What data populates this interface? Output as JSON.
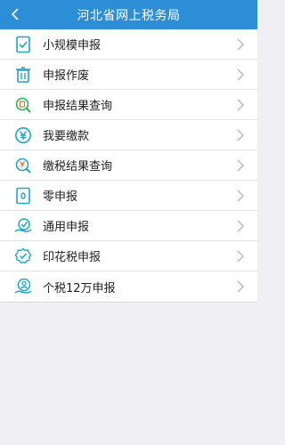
{
  "header": {
    "title": "河北省网上税务局"
  },
  "menu": [
    {
      "label": "小规模申报",
      "icon": "checklist-icon"
    },
    {
      "label": "申报作废",
      "icon": "trash-icon"
    },
    {
      "label": "申报结果查询",
      "icon": "search-document-icon"
    },
    {
      "label": "我要缴款",
      "icon": "yuan-circle-icon"
    },
    {
      "label": "缴税结果查询",
      "icon": "yuan-search-icon"
    },
    {
      "label": "零申报",
      "icon": "zero-document-icon"
    },
    {
      "label": "通用申报",
      "icon": "hand-check-icon"
    },
    {
      "label": "印花税申报",
      "icon": "badge-check-icon"
    },
    {
      "label": "个税12万申报",
      "icon": "person-hand-icon"
    }
  ],
  "colors": {
    "accent": "#2d8ed8",
    "icon": "#1ea7c7",
    "icon_alt": "#e07a2e"
  }
}
